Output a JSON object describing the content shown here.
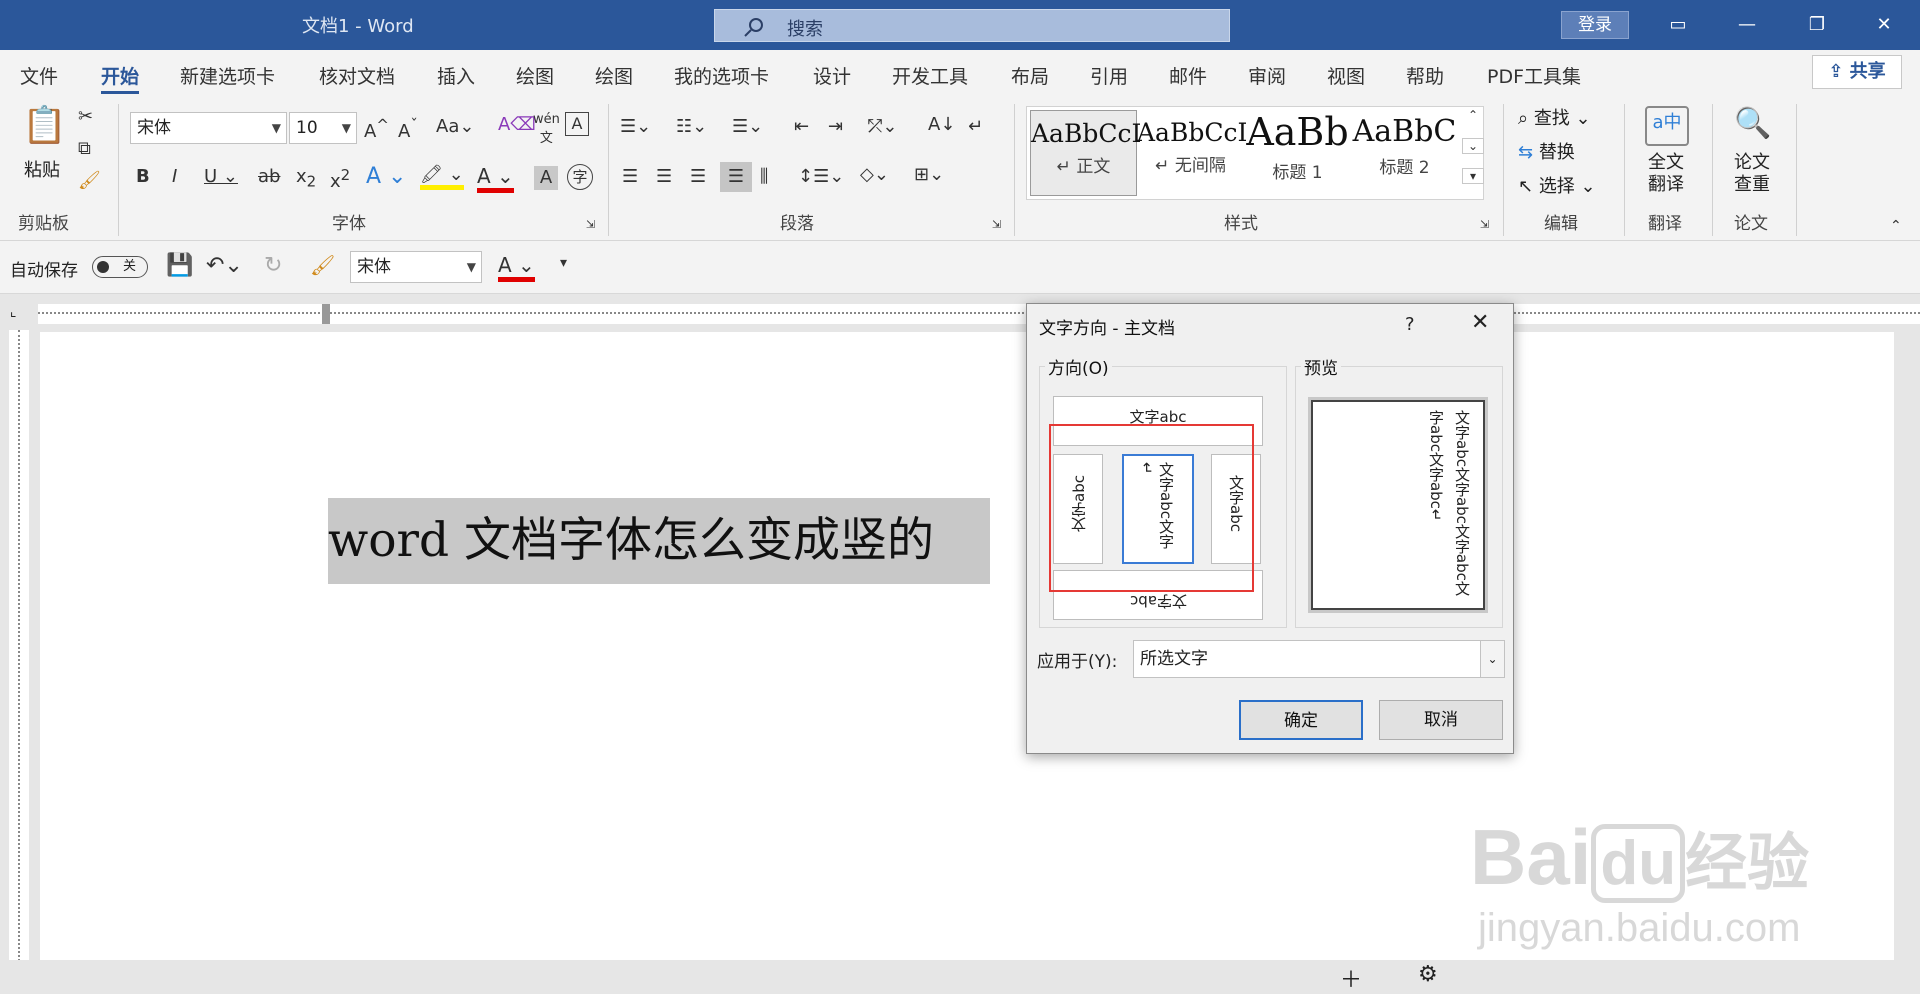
{
  "titlebar": {
    "doc_title": "文档1 - Word",
    "search_placeholder": "搜索",
    "login": "登录"
  },
  "tabs": [
    "文件",
    "开始",
    "新建选项卡",
    "核对文档",
    "插入",
    "绘图",
    "绘图",
    "我的选项卡",
    "设计",
    "开发工具",
    "布局",
    "引用",
    "邮件",
    "审阅",
    "视图",
    "帮助",
    "PDF工具集"
  ],
  "share": "共享",
  "ribbon": {
    "clipboard": {
      "paste": "粘贴",
      "group": "剪贴板"
    },
    "font": {
      "name": "宋体",
      "size": "10",
      "group": "字体",
      "aa": "Aa"
    },
    "paragraph": {
      "group": "段落"
    },
    "styles": {
      "group": "样式",
      "items": [
        {
          "sample": "AaBbCcI",
          "name": "↵ 正文"
        },
        {
          "sample": "AaBbCcI",
          "name": "↵ 无间隔"
        },
        {
          "sample": "AaBb",
          "name": "标题 1"
        },
        {
          "sample": "AaBbC",
          "name": "标题 2"
        }
      ]
    },
    "editing": {
      "find": "查找",
      "replace": "替换",
      "select": "选择",
      "group": "编辑"
    },
    "translate": {
      "label1": "全文",
      "label2": "翻译",
      "group": "翻译"
    },
    "paper": {
      "label1": "论文",
      "label2": "查重",
      "group": "论文"
    }
  },
  "qat": {
    "autosave": "自动保存",
    "toggle": "关",
    "font": "宋体"
  },
  "document": {
    "text": "word 文档字体怎么变成竖的"
  },
  "dialog": {
    "title": "文字方向 - 主文档",
    "help": "?",
    "direction_label": "方向(O)",
    "preview_label": "预览",
    "opt_horizontal": "文字abc",
    "opt_left": "文字abc",
    "opt_center": "文字abc文字↵",
    "opt_right": "文字abc",
    "opt_bottom": "文字abc",
    "preview_text": "文字abc文字abc文字abc文字abc文字abc↵",
    "apply_label": "应用于(Y):",
    "apply_value": "所选文字",
    "ok": "确定",
    "cancel": "取消"
  },
  "watermark": {
    "brand": "Bai",
    "du": "du",
    "cn": "经验",
    "url": "jingyan.baidu.com"
  }
}
